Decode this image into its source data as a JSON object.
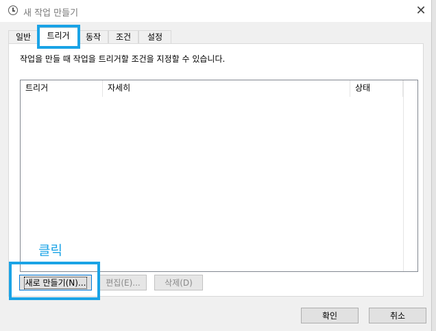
{
  "window": {
    "title": "새 작업 만들기",
    "close_symbol": "✕"
  },
  "tabs": [
    {
      "label": "일반",
      "active": false
    },
    {
      "label": "트리거",
      "active": true
    },
    {
      "label": "동작",
      "active": false
    },
    {
      "label": "조건",
      "active": false
    },
    {
      "label": "설정",
      "active": false
    }
  ],
  "panel": {
    "description": "작업을 만들 때 작업을 트리거할 조건을 지정할 수 있습니다.",
    "columns": [
      "트리거",
      "자세히",
      "상태"
    ],
    "rows": []
  },
  "buttons": {
    "new": "새로 만들기(N)...",
    "edit": "편집(E)...",
    "delete": "삭제(D)",
    "ok": "확인",
    "cancel": "취소"
  },
  "annotation": {
    "text": "클릭",
    "color": "#1aa3e6"
  }
}
